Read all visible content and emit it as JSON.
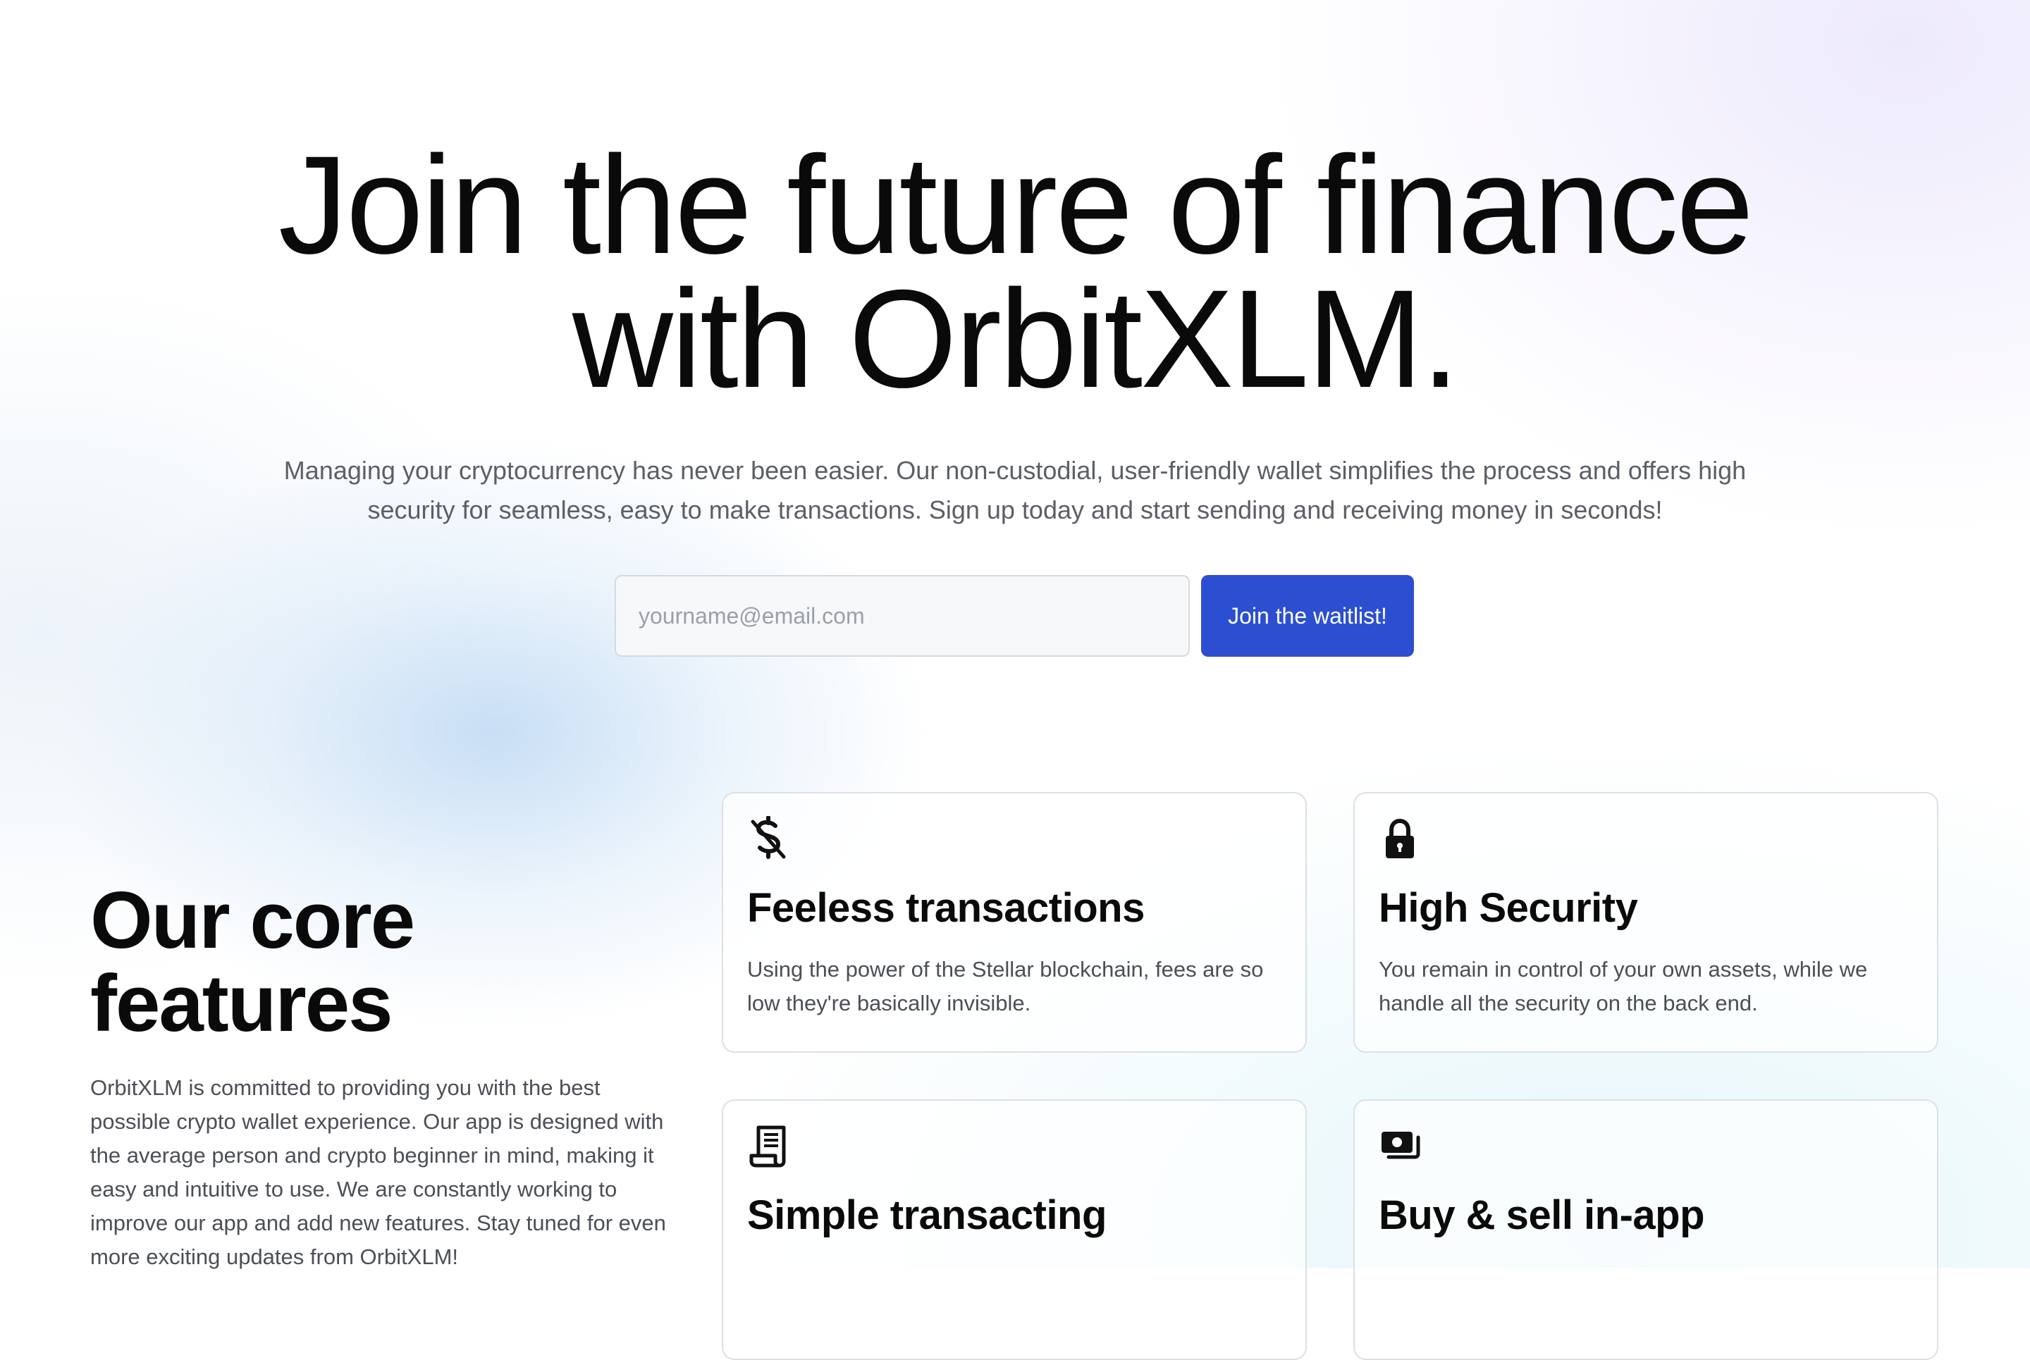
{
  "hero": {
    "title_line1": "Join the future of finance",
    "title_line2": "with OrbitXLM.",
    "subtitle": "Managing your cryptocurrency has never been easier. Our non-custodial, user-friendly wallet simplifies the process and offers high security for seamless, easy to make transactions. Sign up today and start sending and receiving money in seconds!"
  },
  "waitlist": {
    "email_placeholder": "yourname@email.com",
    "email_value": "",
    "button_label": "Join the waitlist!"
  },
  "core": {
    "title_line1": "Our core",
    "title_line2": "features",
    "description": "OrbitXLM is committed to providing you with the best possible crypto wallet experience. Our app is designed with the average person and crypto beginner in mind, making it easy and intuitive to use. We are constantly working to improve our app and add new features. Stay tuned for even more exciting updates from OrbitXLM!"
  },
  "features": [
    {
      "icon": "no-dollar-icon",
      "title": "Feeless transactions",
      "description": "Using the power of the Stellar blockchain, fees are so low they're basically invisible."
    },
    {
      "icon": "lock-icon",
      "title": "High Security",
      "description": "You remain in control of your own assets, while we handle all the security on the back end."
    },
    {
      "icon": "receipt-icon",
      "title": "Simple transacting",
      "description": ""
    },
    {
      "icon": "cash-stack-icon",
      "title": "Buy & sell in-app",
      "description": ""
    }
  ],
  "colors": {
    "accent": "#2c4fd1",
    "heading": "#0a0a0a",
    "body_text": "#4b4f56",
    "subtitle_text": "#5b5f66",
    "card_border": "#dde0e5"
  }
}
